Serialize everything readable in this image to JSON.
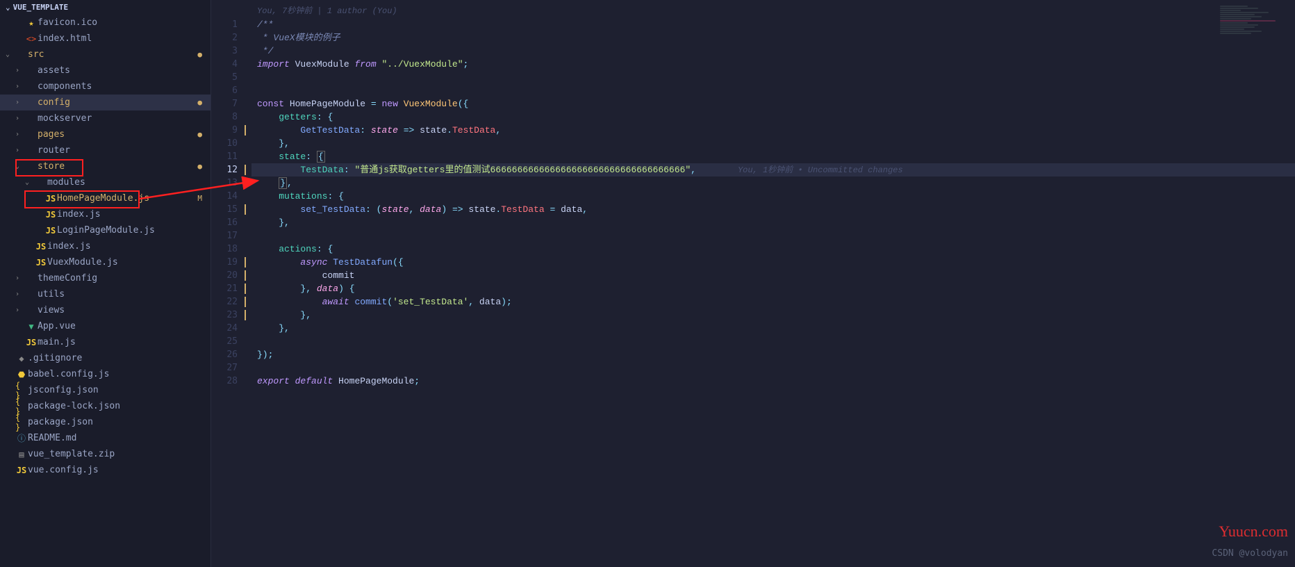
{
  "sidebar": {
    "title": "VUE_TEMPLATE",
    "items": [
      {
        "label": "favicon.ico",
        "icon": "star",
        "indent": 1
      },
      {
        "label": "index.html",
        "icon": "html",
        "indent": 1
      },
      {
        "label": "src",
        "icon": "folder",
        "indent": 0,
        "chevron": "down",
        "modified": true
      },
      {
        "label": "assets",
        "icon": "folder",
        "indent": 1,
        "chevron": "right"
      },
      {
        "label": "components",
        "icon": "folder",
        "indent": 1,
        "chevron": "right"
      },
      {
        "label": "config",
        "icon": "folder",
        "indent": 1,
        "chevron": "right",
        "modified": true,
        "selected": true
      },
      {
        "label": "mockserver",
        "icon": "folder",
        "indent": 1,
        "chevron": "right"
      },
      {
        "label": "pages",
        "icon": "folder",
        "indent": 1,
        "chevron": "right",
        "modified": true
      },
      {
        "label": "router",
        "icon": "folder",
        "indent": 1,
        "chevron": "right"
      },
      {
        "label": "store",
        "icon": "folder",
        "indent": 1,
        "chevron": "down",
        "modified": true
      },
      {
        "label": "modules",
        "icon": "folder",
        "indent": 2,
        "chevron": "down"
      },
      {
        "label": "HomePageModule.js",
        "icon": "js",
        "indent": 3,
        "modified": true,
        "modLetter": "M"
      },
      {
        "label": "index.js",
        "icon": "js",
        "indent": 3
      },
      {
        "label": "LoginPageModule.js",
        "icon": "js",
        "indent": 3
      },
      {
        "label": "index.js",
        "icon": "js",
        "indent": 2
      },
      {
        "label": "VuexModule.js",
        "icon": "js",
        "indent": 2
      },
      {
        "label": "themeConfig",
        "icon": "folder",
        "indent": 1,
        "chevron": "right"
      },
      {
        "label": "utils",
        "icon": "folder",
        "indent": 1,
        "chevron": "right"
      },
      {
        "label": "views",
        "icon": "folder",
        "indent": 1,
        "chevron": "right"
      },
      {
        "label": "App.vue",
        "icon": "vue",
        "indent": 1
      },
      {
        "label": "main.js",
        "icon": "js",
        "indent": 1
      },
      {
        "label": ".gitignore",
        "icon": "git",
        "indent": 0
      },
      {
        "label": "babel.config.js",
        "icon": "babel",
        "indent": 0
      },
      {
        "label": "jsconfig.json",
        "icon": "json",
        "indent": 0
      },
      {
        "label": "package-lock.json",
        "icon": "json",
        "indent": 0
      },
      {
        "label": "package.json",
        "icon": "json",
        "indent": 0
      },
      {
        "label": "README.md",
        "icon": "md",
        "indent": 0
      },
      {
        "label": "vue_template.zip",
        "icon": "zip",
        "indent": 0
      },
      {
        "label": "vue.config.js",
        "icon": "js",
        "indent": 0
      }
    ]
  },
  "editor": {
    "blame_top": "You, 7秒钟前 | 1 author (You)",
    "inline_blame": "You, 1秒钟前 • Uncommitted changes",
    "lines": {
      "l1": "/**",
      "l2": " * VueX模块的例子",
      "l3": " */",
      "l4_import": "import",
      "l4_mod": "VuexModule",
      "l4_from": "from",
      "l4_path": "\"../VuexModule\"",
      "l7_const": "const",
      "l7_name": "HomePageModule",
      "l7_new": "new",
      "l7_ctor": "VuexModule",
      "l8_getters": "getters",
      "l9_fn": "GetTestData",
      "l9_param": "state",
      "l9_state": "state",
      "l9_prop": "TestData",
      "l11_state": "state",
      "l12_key": "TestData",
      "l12_val": "\"普通js获取getters里的值测试666666666666666666666666666666666666\"",
      "l14_mut": "mutations",
      "l15_fn": "set_TestData",
      "l15_p1": "state",
      "l15_p2": "data",
      "l15_state": "state",
      "l15_prop": "TestData",
      "l15_data": "data",
      "l18_act": "actions",
      "l19_async": "async",
      "l19_fn": "TestDatafun",
      "l20_commit": "commit",
      "l21_data": "data",
      "l22_await": "await",
      "l22_commit": "commit",
      "l22_arg1": "'set_TestData'",
      "l22_arg2": "data",
      "l28_export": "export",
      "l28_default": "default",
      "l28_name": "HomePageModule"
    },
    "line_numbers": [
      "1",
      "2",
      "3",
      "4",
      "5",
      "6",
      "7",
      "8",
      "9",
      "10",
      "11",
      "12",
      "13",
      "14",
      "15",
      "16",
      "17",
      "18",
      "19",
      "20",
      "21",
      "22",
      "23",
      "24",
      "25",
      "26",
      "27",
      "28"
    ]
  },
  "watermarks": {
    "w1": "Yuucn.com",
    "w2": "CSDN @volodyan"
  }
}
